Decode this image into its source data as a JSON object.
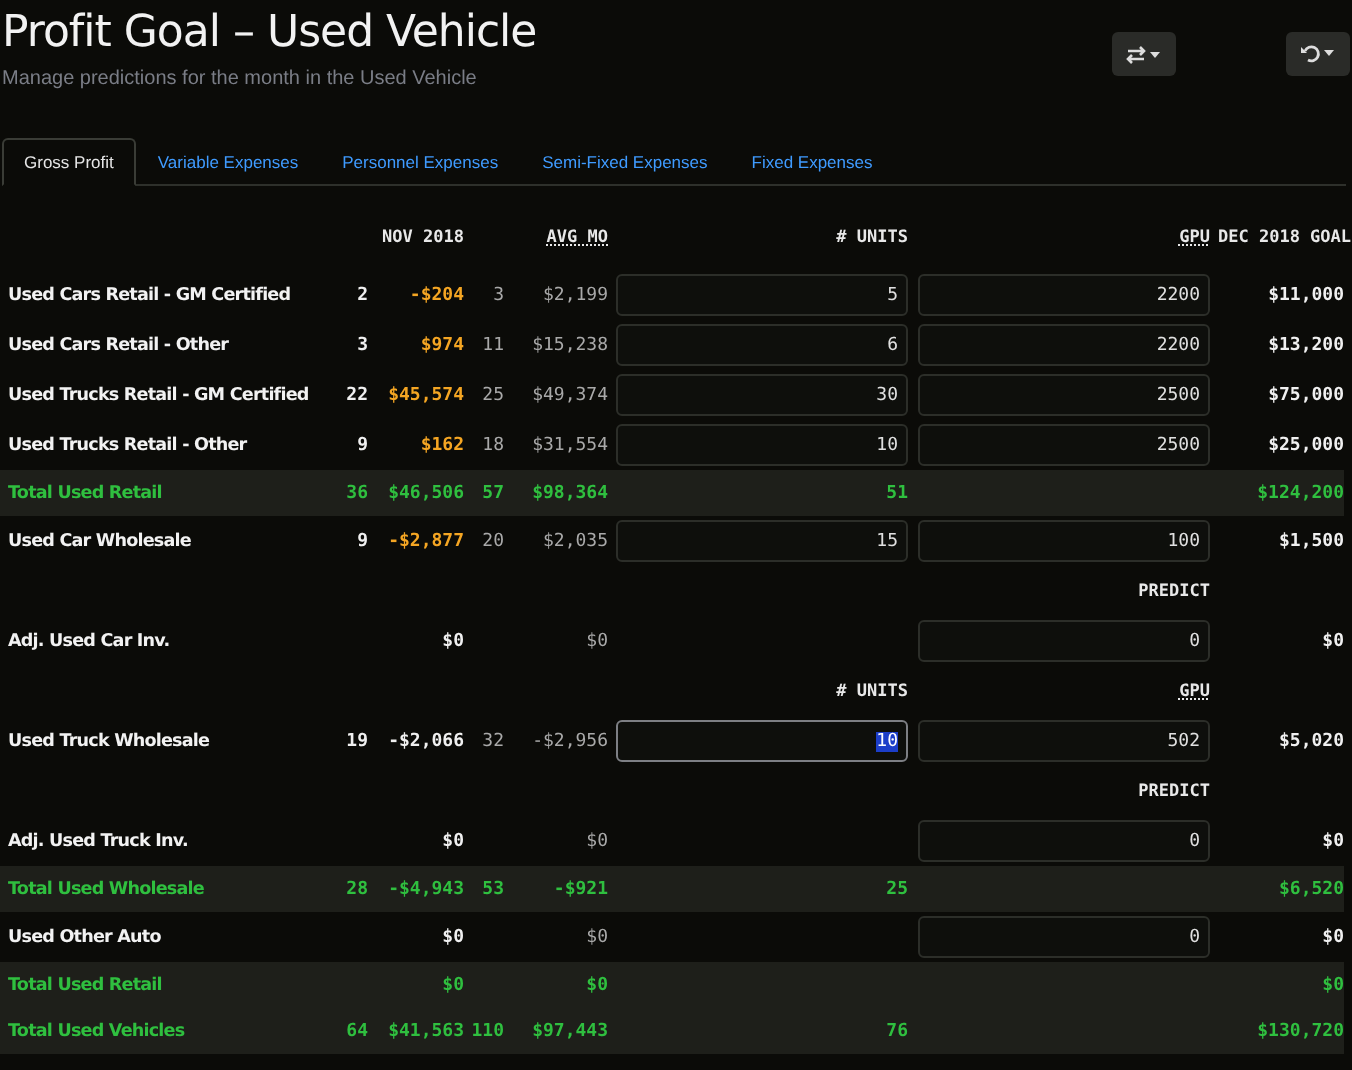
{
  "title": "Profit Goal – Used Vehicle",
  "subtitle": "Manage predictions for the month in the Used Vehicle",
  "toolbar": [
    {
      "kind": "swap"
    },
    {
      "kind": "undo"
    }
  ],
  "tabs": [
    {
      "label": "Gross Profit",
      "selected": true
    },
    {
      "label": "Variable Expenses",
      "selected": false
    },
    {
      "label": "Personnel Expenses",
      "selected": false
    },
    {
      "label": "Semi-Fixed Expenses",
      "selected": false
    },
    {
      "label": "Fixed Expenses",
      "selected": false
    }
  ],
  "header": {
    "nov": "NOV 2018",
    "avg": "AVG MO",
    "units": "# UNITS",
    "gpu": "GPU",
    "goal": "DEC 2018 GOAL"
  },
  "rows": [
    {
      "kind": "data",
      "label": "Used Cars Retail - GM Certified",
      "nov_units": "2",
      "nov_amount": "-$204",
      "highlight": true,
      "avg_units": "3",
      "avg_amount": "$2,199",
      "units_input": "5",
      "gpu_input": "2200",
      "goal": "$11,000"
    },
    {
      "kind": "data",
      "label": "Used Cars Retail - Other",
      "nov_units": "3",
      "nov_amount": "$974",
      "highlight": true,
      "avg_units": "11",
      "avg_amount": "$15,238",
      "units_input": "6",
      "gpu_input": "2200",
      "goal": "$13,200"
    },
    {
      "kind": "data",
      "label": "Used Trucks Retail - GM Certified",
      "nov_units": "22",
      "nov_amount": "$45,574",
      "highlight": true,
      "avg_units": "25",
      "avg_amount": "$49,374",
      "units_input": "30",
      "gpu_input": "2500",
      "goal": "$75,000"
    },
    {
      "kind": "data",
      "label": "Used Trucks Retail - Other",
      "nov_units": "9",
      "nov_amount": "$162",
      "highlight": true,
      "avg_units": "18",
      "avg_amount": "$31,554",
      "units_input": "10",
      "gpu_input": "2500",
      "goal": "$25,000"
    },
    {
      "kind": "total",
      "label": "Total Used Retail",
      "nov_units": "36",
      "nov_amount": "$46,506",
      "avg_units": "57",
      "avg_amount": "$98,364",
      "units": "51",
      "goal": "$124,200"
    },
    {
      "kind": "data",
      "label": "Used Car Wholesale",
      "nov_units": "9",
      "nov_amount": "-$2,877",
      "highlight": true,
      "avg_units": "20",
      "avg_amount": "$2,035",
      "units_input": "15",
      "gpu_input": "100",
      "goal": "$1,500"
    },
    {
      "kind": "subheader",
      "gpu": "PREDICT",
      "gpu_underlined": false
    },
    {
      "kind": "data",
      "label": "Adj. Used Car Inv.",
      "nov_amount": "$0",
      "highlight": false,
      "avg_amount": "$0",
      "gpu_input": "0",
      "goal": "$0"
    },
    {
      "kind": "subheader",
      "units": "# UNITS",
      "gpu": "GPU",
      "gpu_underlined": true
    },
    {
      "kind": "data",
      "label": "Used Truck Wholesale",
      "nov_units": "19",
      "nov_amount": "-$2,066",
      "highlight": false,
      "avg_units": "32",
      "avg_amount": "-$2,956",
      "units_input": "10",
      "units_focused": true,
      "gpu_input": "502",
      "goal": "$5,020"
    },
    {
      "kind": "subheader",
      "gpu": "PREDICT",
      "gpu_underlined": false
    },
    {
      "kind": "data",
      "label": "Adj. Used Truck Inv.",
      "nov_amount": "$0",
      "highlight": false,
      "avg_amount": "$0",
      "gpu_input": "0",
      "goal": "$0"
    },
    {
      "kind": "total",
      "label": "Total Used Wholesale",
      "nov_units": "28",
      "nov_amount": "-$4,943",
      "avg_units": "53",
      "avg_amount": "-$921",
      "units": "25",
      "goal": "$6,520"
    },
    {
      "kind": "data",
      "label": "Used Other Auto",
      "nov_amount": "$0",
      "highlight": false,
      "avg_amount": "$0",
      "gpu_input": "0",
      "goal": "$0"
    },
    {
      "kind": "total",
      "label": "Total Used Retail",
      "nov_amount": "$0",
      "avg_amount": "$0",
      "goal": "$0"
    },
    {
      "kind": "total",
      "label": "Total Used Vehicles",
      "nov_units": "64",
      "nov_amount": "$41,563",
      "avg_units": "110",
      "avg_amount": "$97,443",
      "units": "76",
      "goal": "$130,720"
    }
  ]
}
